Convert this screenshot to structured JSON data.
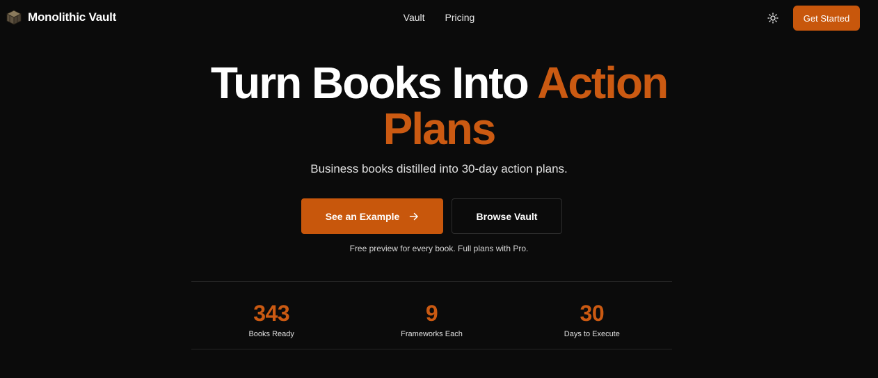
{
  "header": {
    "brand": "Monolithic Vault",
    "brand_icon": "box-logo-icon",
    "nav": [
      {
        "label": "Vault"
      },
      {
        "label": "Pricing"
      }
    ],
    "theme_icon": "sun-icon",
    "cta": "Get Started"
  },
  "hero": {
    "title_plain": "Turn Books Into ",
    "title_accent_1": "Action",
    "title_accent_2": "Plans",
    "subtitle": "Business books distilled into 30-day action plans.",
    "primary_button": "See an Example",
    "primary_button_icon": "arrow-right-icon",
    "secondary_button": "Browse Vault",
    "note": "Free preview for every book. Full plans with Pro."
  },
  "stats": [
    {
      "value": "343",
      "label": "Books Ready"
    },
    {
      "value": "9",
      "label": "Frameworks Each"
    },
    {
      "value": "30",
      "label": "Days to Execute"
    }
  ],
  "colors": {
    "background": "#0b0b0b",
    "accent": "#c8570c",
    "accent_text": "#cb5a12",
    "text": "#ffffff"
  }
}
